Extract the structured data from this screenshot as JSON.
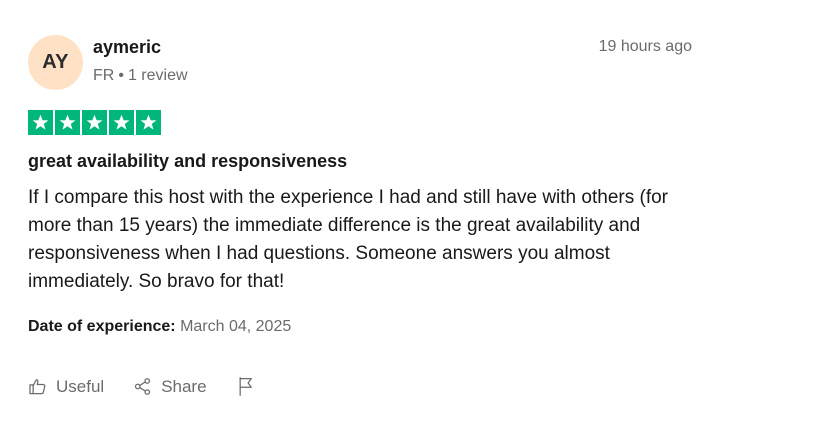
{
  "reviewer": {
    "initials": "AY",
    "name": "aymeric",
    "country": "FR",
    "separator": "•",
    "review_count": "1 review",
    "avatar_color": "#ffe2c6"
  },
  "review": {
    "time_ago": "19 hours ago",
    "rating": 5,
    "star_color": "#00b67a",
    "title": "great availability and responsiveness",
    "body": "If I compare this host with the experience I had and still have with others (for more than 15 years) the immediate difference is the great availability and responsiveness when I had questions. Someone answers you almost immediately. So bravo for that!",
    "date_label": "Date of experience:",
    "date_value": "March 04, 2025"
  },
  "actions": {
    "useful_label": "Useful",
    "share_label": "Share",
    "useful_icon": "thumbs-up-icon",
    "share_icon": "share-icon",
    "report_icon": "flag-icon"
  }
}
